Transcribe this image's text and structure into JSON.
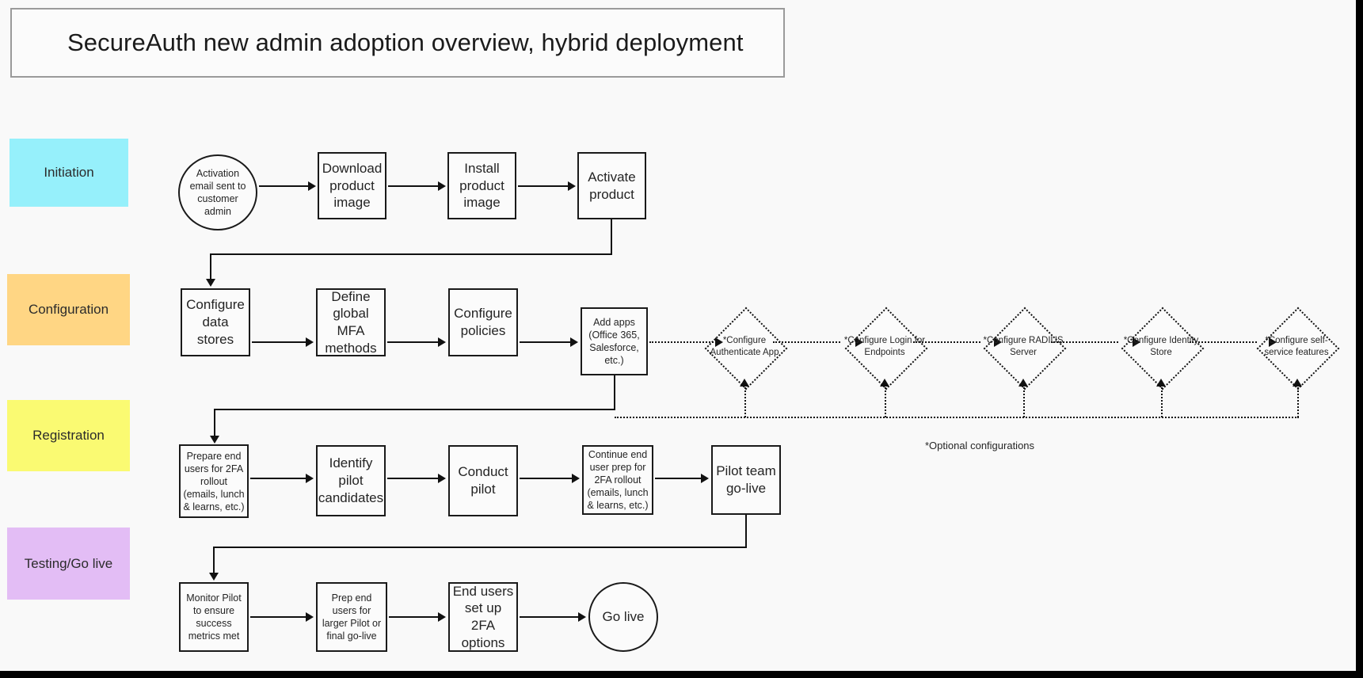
{
  "title": "SecureAuth new admin adoption overview, hybrid deployment",
  "lanes": [
    {
      "label": "Initiation",
      "color": "#96f0fb"
    },
    {
      "label": "Configuration",
      "color": "#ffd684"
    },
    {
      "label": "Registration",
      "color": "#fafa72"
    },
    {
      "label": "Testing/Go live",
      "color": "#e3bdf5"
    }
  ],
  "initiation": {
    "start": "Activation email sent to customer  admin",
    "steps": [
      "Download product image",
      "Install product image",
      "Activate product"
    ]
  },
  "configuration": {
    "steps": [
      "Configure data stores",
      "Define global MFA methods",
      "Configure policies",
      "Add apps (Office 365, Salesforce, etc.)"
    ],
    "optional": [
      "*Configure Authenticate App",
      "*Configure Login for Endpoints",
      "*Configure RADIUS Server",
      "*Configure Identity Store",
      "*Configure self-service features"
    ],
    "optional_note": "*Optional configurations"
  },
  "registration": {
    "steps": [
      "Prepare end users for 2FA rollout (emails, lunch & learns, etc.)",
      "Identify pilot candidates",
      "Conduct pilot",
      "Continue end user prep for 2FA rollout (emails, lunch & learns, etc.)",
      "Pilot team go-live"
    ]
  },
  "testing": {
    "steps": [
      "Monitor Pilot to ensure success metrics met",
      "Prep end users for larger Pilot or final go-live",
      "End users set up 2FA options"
    ],
    "end": "Go live"
  }
}
